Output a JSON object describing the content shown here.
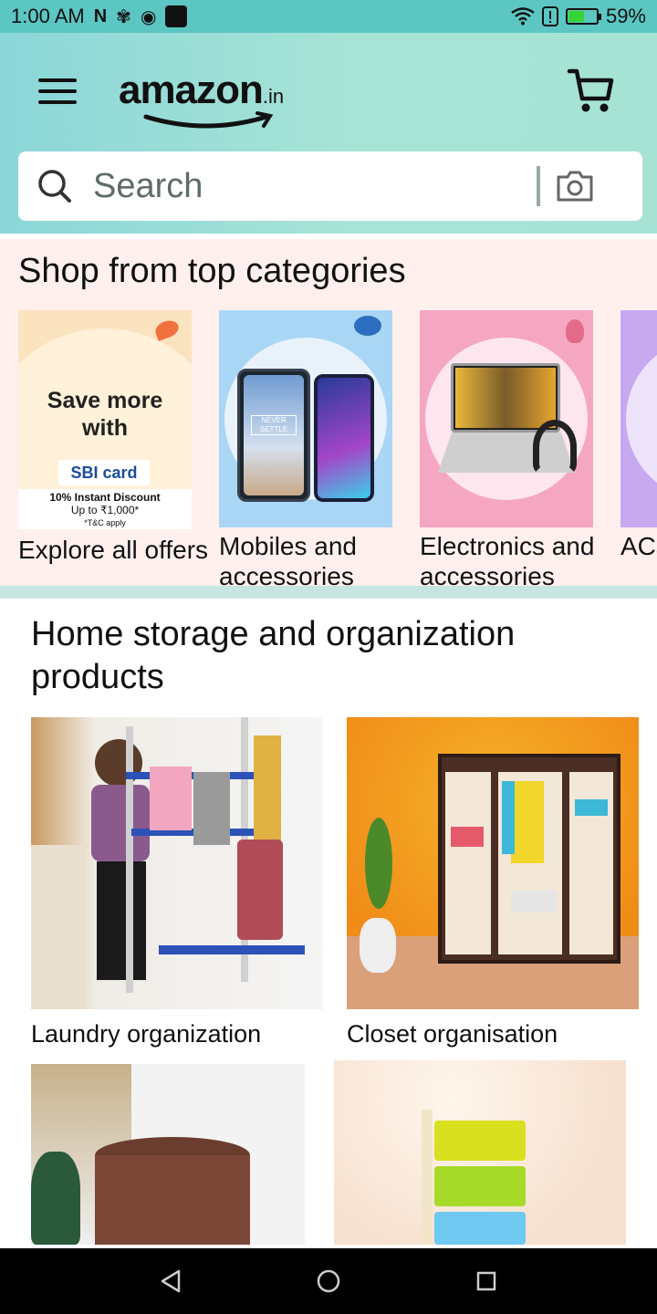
{
  "status_bar": {
    "time": "1:00 AM",
    "battery_percent": "59%",
    "battery_level": 0.59
  },
  "header": {
    "logo_text": "amazon",
    "logo_suffix": ".in",
    "search_placeholder": "Search"
  },
  "categories": {
    "title": "Shop from top categories",
    "items": [
      {
        "label": "Explore all offers",
        "promo_line1": "Save more",
        "promo_line2": "with",
        "card_brand": "SBI card",
        "discount": "10% Instant Discount",
        "discount_sub": "Up to ₹1,000*",
        "tc": "*T&C apply"
      },
      {
        "label": "Mobiles and accessories",
        "phone_text": "NEVER SETTLE"
      },
      {
        "label": "Electronics and accessories"
      },
      {
        "label": "ACs and"
      }
    ]
  },
  "home_storage": {
    "title": "Home storage and organization products",
    "items": [
      {
        "label": "Laundry organization"
      },
      {
        "label": "Closet organisation"
      },
      {
        "label": ""
      },
      {
        "label": ""
      }
    ]
  },
  "colors": {
    "status_bar": "#5cc6c3",
    "header_gradient_start": "#8bd6d8",
    "header_gradient_end": "#a6e3d5",
    "categories_bg": "#fff0ee",
    "nav_bar": "#000000"
  },
  "icons": [
    "menu-icon",
    "cart-icon",
    "search-icon",
    "camera-icon",
    "back-icon",
    "home-icon",
    "recents-icon"
  ]
}
